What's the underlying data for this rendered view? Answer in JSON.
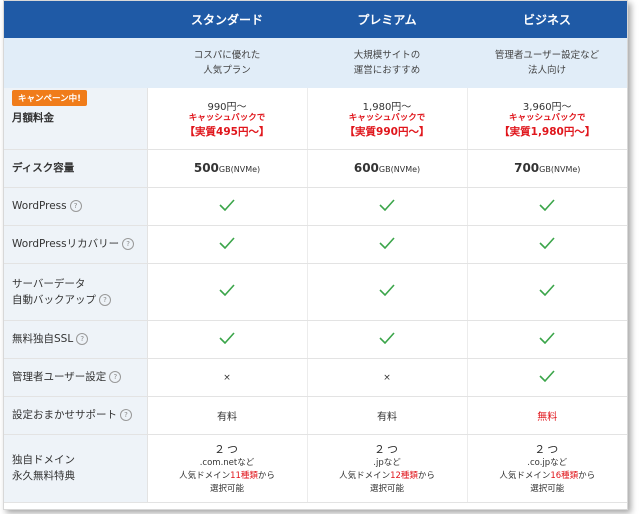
{
  "plans": [
    "スタンダード",
    "プレミアム",
    "ビジネス"
  ],
  "subtitles": [
    [
      "コスパに優れた",
      "人気プラン"
    ],
    [
      "大規模サイトの",
      "運営におすすめ"
    ],
    [
      "管理者ユーザー設定など",
      "法人向け"
    ]
  ],
  "campaign_badge": "キャンペーン中!",
  "rows": {
    "monthly": {
      "label": "月額料金",
      "values": [
        {
          "base": "990円〜",
          "cashback": "キャッシュバックで",
          "real": "【実質495円〜】"
        },
        {
          "base": "1,980円〜",
          "cashback": "キャッシュバックで",
          "real": "【実質990円〜】"
        },
        {
          "base": "3,960円〜",
          "cashback": "キャッシュバックで",
          "real": "【実質1,980円〜】"
        }
      ]
    },
    "disk": {
      "label": "ディスク容量",
      "values": [
        {
          "num": "500",
          "unit": "GB(NVMe)"
        },
        {
          "num": "600",
          "unit": "GB(NVMe)"
        },
        {
          "num": "700",
          "unit": "GB(NVMe)"
        }
      ]
    },
    "wordpress": {
      "label": "WordPress"
    },
    "wp_recovery": {
      "label": "WordPressリカバリー"
    },
    "backup": {
      "label_line1": "サーバーデータ",
      "label_line2": "自動バックアップ"
    },
    "ssl": {
      "label": "無料独自SSL"
    },
    "admin_user": {
      "label": "管理者ユーザー設定",
      "values": [
        "×",
        "×"
      ]
    },
    "setup_support": {
      "label": "設定おまかせサポート",
      "values": [
        "有料",
        "有料",
        "無料"
      ]
    },
    "domain": {
      "label_line1": "独自ドメイン",
      "label_line2": "永久無料特典",
      "values": [
        {
          "count": "２つ",
          "tld": ".com.netなど",
          "pre": "人気ドメイン",
          "num": "11種類",
          "post": "から",
          "last": "選択可能"
        },
        {
          "count": "２つ",
          "tld": ".jpなど",
          "pre": "人気ドメイン",
          "num": "12種類",
          "post": "から",
          "last": "選択可能"
        },
        {
          "count": "２つ",
          "tld": ".co.jpなど",
          "pre": "人気ドメイン",
          "num": "16種類",
          "post": "から",
          "last": "選択可能"
        }
      ]
    }
  },
  "help_icon": "?",
  "colors": {
    "header_bg": "#1f5aa6",
    "accent_red": "#e0161c",
    "badge_orange": "#f07c1a",
    "check_green": "#3ba54a"
  }
}
